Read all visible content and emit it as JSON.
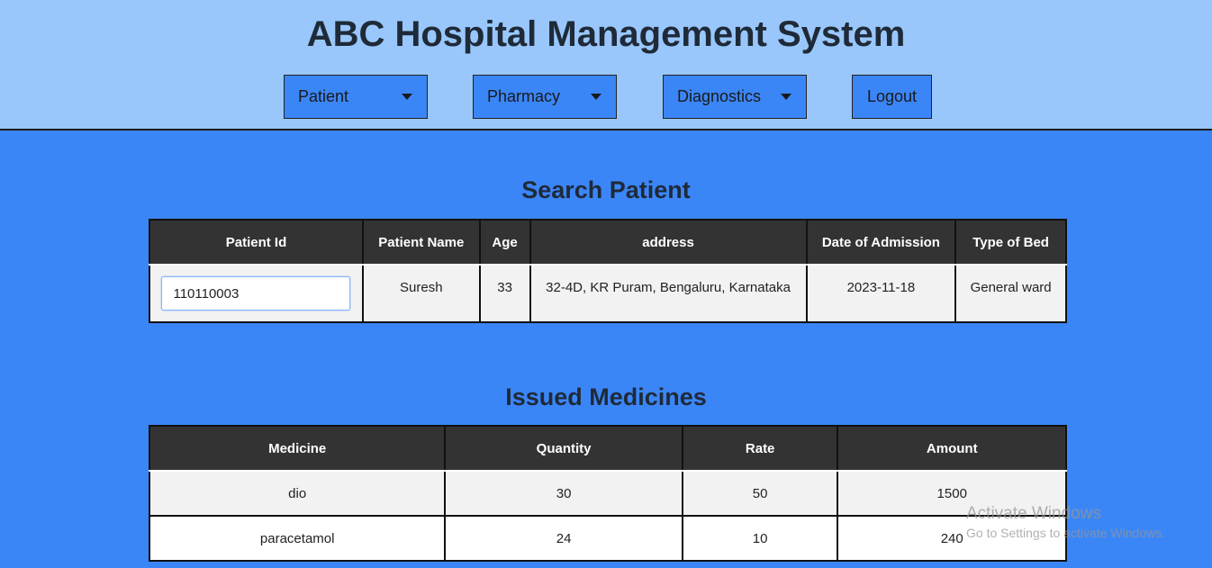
{
  "app": {
    "title": "ABC Hospital Management System"
  },
  "nav": {
    "patient": "Patient",
    "pharmacy": "Pharmacy",
    "diagnostics": "Diagnostics",
    "logout": "Logout"
  },
  "search_patient": {
    "title": "Search Patient",
    "columns": [
      "Patient Id",
      "Patient Name",
      "Age",
      "address",
      "Date of Admission",
      "Type of Bed"
    ],
    "patient_id_value": "110110003",
    "row": {
      "name": "Suresh",
      "age": "33",
      "address": "32-4D, KR Puram, Bengaluru, Karnataka",
      "date_of_admission": "2023-11-18",
      "bed_type": "General ward"
    }
  },
  "issued_medicines": {
    "title": "Issued Medicines",
    "columns": [
      "Medicine",
      "Quantity",
      "Rate",
      "Amount"
    ],
    "rows": [
      {
        "medicine": "dio",
        "quantity": "30",
        "rate": "50",
        "amount": "1500"
      },
      {
        "medicine": "paracetamol",
        "quantity": "24",
        "rate": "10",
        "amount": "240"
      }
    ]
  },
  "watermark": {
    "line1": "Activate Windows",
    "line2": "Go to Settings to activate Windows."
  }
}
